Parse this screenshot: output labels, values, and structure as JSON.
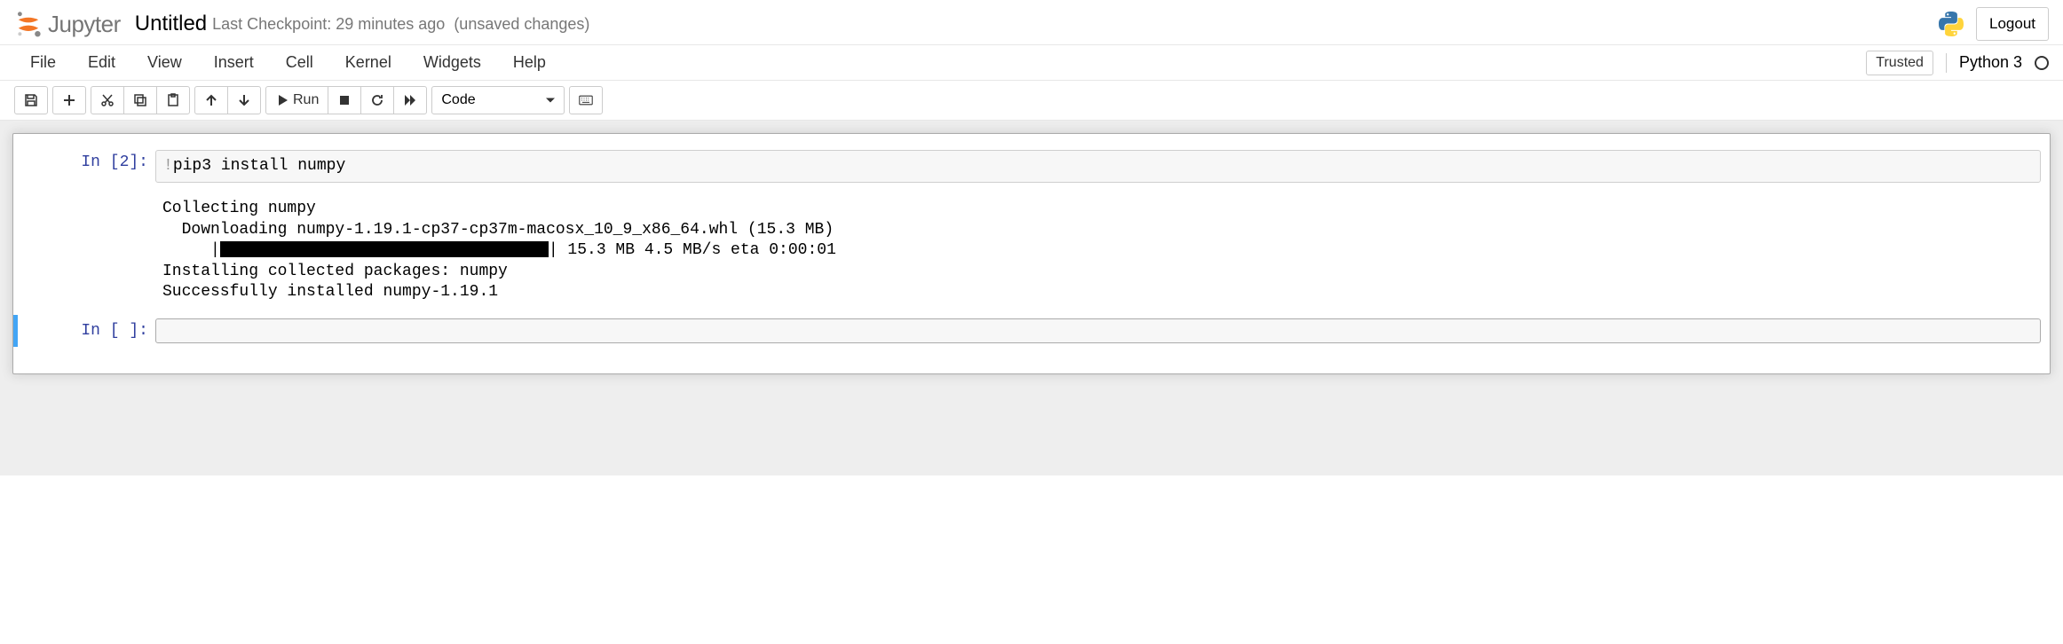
{
  "header": {
    "logo_text": "Jupyter",
    "title": "Untitled",
    "checkpoint": "Last Checkpoint: 29 minutes ago",
    "unsaved": "(unsaved changes)",
    "logout": "Logout"
  },
  "menubar": {
    "items": [
      "File",
      "Edit",
      "View",
      "Insert",
      "Cell",
      "Kernel",
      "Widgets",
      "Help"
    ],
    "trusted": "Trusted",
    "kernel": "Python 3"
  },
  "toolbar": {
    "run_label": "Run",
    "celltype": "Code"
  },
  "cells": [
    {
      "prompt": "In [2]:",
      "code_prefix": "!",
      "code_body": "pip3 install numpy",
      "output": {
        "line1": "Collecting numpy",
        "line2": "  Downloading numpy-1.19.1-cp37-cp37m-macosx_10_9_x86_64.whl (15.3 MB)",
        "line3_prefix": "     |",
        "line3_suffix": "| 15.3 MB 4.5 MB/s eta 0:00:01",
        "line4": "Installing collected packages: numpy",
        "line5": "Successfully installed numpy-1.19.1"
      }
    },
    {
      "prompt": "In [ ]:",
      "code": ""
    }
  ]
}
